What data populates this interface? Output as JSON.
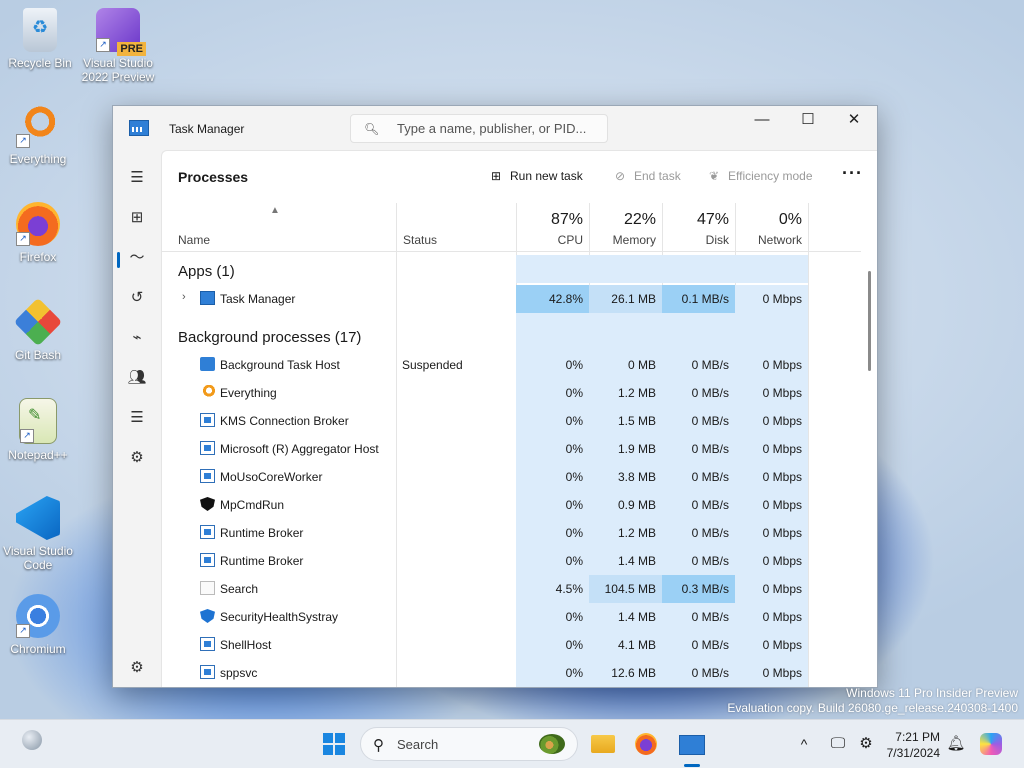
{
  "desktop": {
    "icons": [
      {
        "label": "Recycle Bin"
      },
      {
        "label": "Visual Studio 2022 Preview",
        "badge": "PRE"
      },
      {
        "label": "Everything"
      },
      {
        "label": "Firefox"
      },
      {
        "label": "Git Bash"
      },
      {
        "label": "Notepad++"
      },
      {
        "label": "Visual Studio Code"
      },
      {
        "label": "Chromium"
      }
    ],
    "watermark": {
      "line1": "Windows 11 Pro Insider Preview",
      "line2": "Evaluation copy. Build 26080.ge_release.240308-1400"
    }
  },
  "window": {
    "title": "Task Manager",
    "search_placeholder": "Type a name, publisher, or PID...",
    "controls": {
      "minimize": "—",
      "maximize": "☐",
      "close": "✕"
    }
  },
  "nav": {
    "items": [
      "hamburger-menu",
      "processes",
      "performance",
      "app-history",
      "startup-apps",
      "users",
      "details",
      "services",
      "settings"
    ],
    "selected": "processes"
  },
  "toolbar": {
    "page_title": "Processes",
    "run_new_task": "Run new task",
    "end_task": "End task",
    "efficiency_mode": "Efficiency mode",
    "more": "···"
  },
  "columns": {
    "name": "Name",
    "status": "Status",
    "cpu": {
      "pct": "87%",
      "label": "CPU"
    },
    "memory": {
      "pct": "22%",
      "label": "Memory"
    },
    "disk": {
      "pct": "47%",
      "label": "Disk"
    },
    "network": {
      "pct": "0%",
      "label": "Network"
    }
  },
  "groups": {
    "apps": "Apps (1)",
    "background": "Background processes (17)"
  },
  "apps": [
    {
      "name": "Task Manager",
      "status": "",
      "cpu": "42.8%",
      "memory": "26.1 MB",
      "disk": "0.1 MB/s",
      "network": "0 Mbps"
    }
  ],
  "background": [
    {
      "name": "Background Task Host",
      "status": "Suspended",
      "cpu": "0%",
      "memory": "0 MB",
      "disk": "0 MB/s",
      "network": "0 Mbps",
      "icon": "blue-app-icon"
    },
    {
      "name": "Everything",
      "status": "",
      "cpu": "0%",
      "memory": "1.2 MB",
      "disk": "0 MB/s",
      "network": "0 Mbps",
      "icon": "everything-icon"
    },
    {
      "name": "KMS Connection Broker",
      "status": "",
      "cpu": "0%",
      "memory": "1.5 MB",
      "disk": "0 MB/s",
      "network": "0 Mbps",
      "icon": "window-app-icon"
    },
    {
      "name": "Microsoft (R) Aggregator Host",
      "status": "",
      "cpu": "0%",
      "memory": "1.9 MB",
      "disk": "0 MB/s",
      "network": "0 Mbps",
      "icon": "window-app-icon"
    },
    {
      "name": "MoUsoCoreWorker",
      "status": "",
      "cpu": "0%",
      "memory": "3.8 MB",
      "disk": "0 MB/s",
      "network": "0 Mbps",
      "icon": "window-app-icon"
    },
    {
      "name": "MpCmdRun",
      "status": "",
      "cpu": "0%",
      "memory": "0.9 MB",
      "disk": "0 MB/s",
      "network": "0 Mbps",
      "icon": "defender-shield-icon"
    },
    {
      "name": "Runtime Broker",
      "status": "",
      "cpu": "0%",
      "memory": "1.2 MB",
      "disk": "0 MB/s",
      "network": "0 Mbps",
      "icon": "window-app-icon"
    },
    {
      "name": "Runtime Broker",
      "status": "",
      "cpu": "0%",
      "memory": "1.4 MB",
      "disk": "0 MB/s",
      "network": "0 Mbps",
      "icon": "window-app-icon"
    },
    {
      "name": "Search",
      "status": "",
      "cpu": "4.5%",
      "memory": "104.5 MB",
      "disk": "0.3 MB/s",
      "network": "0 Mbps",
      "icon": "search-app-icon"
    },
    {
      "name": "SecurityHealthSystray",
      "status": "",
      "cpu": "0%",
      "memory": "1.4 MB",
      "disk": "0 MB/s",
      "network": "0 Mbps",
      "icon": "security-shield-icon"
    },
    {
      "name": "ShellHost",
      "status": "",
      "cpu": "0%",
      "memory": "4.1 MB",
      "disk": "0 MB/s",
      "network": "0 Mbps",
      "icon": "window-app-icon"
    },
    {
      "name": "sppsvc",
      "status": "",
      "cpu": "0%",
      "memory": "12.6 MB",
      "disk": "0 MB/s",
      "network": "0 Mbps",
      "icon": "window-app-icon"
    }
  ],
  "heat_colors": {
    "light": "#dcecfb",
    "mid": "#c4e0f7",
    "strong": "#9bd0f5"
  },
  "taskbar": {
    "search_label": "Search",
    "time": "7:21 PM",
    "date": "7/31/2024",
    "chevron": "^"
  }
}
